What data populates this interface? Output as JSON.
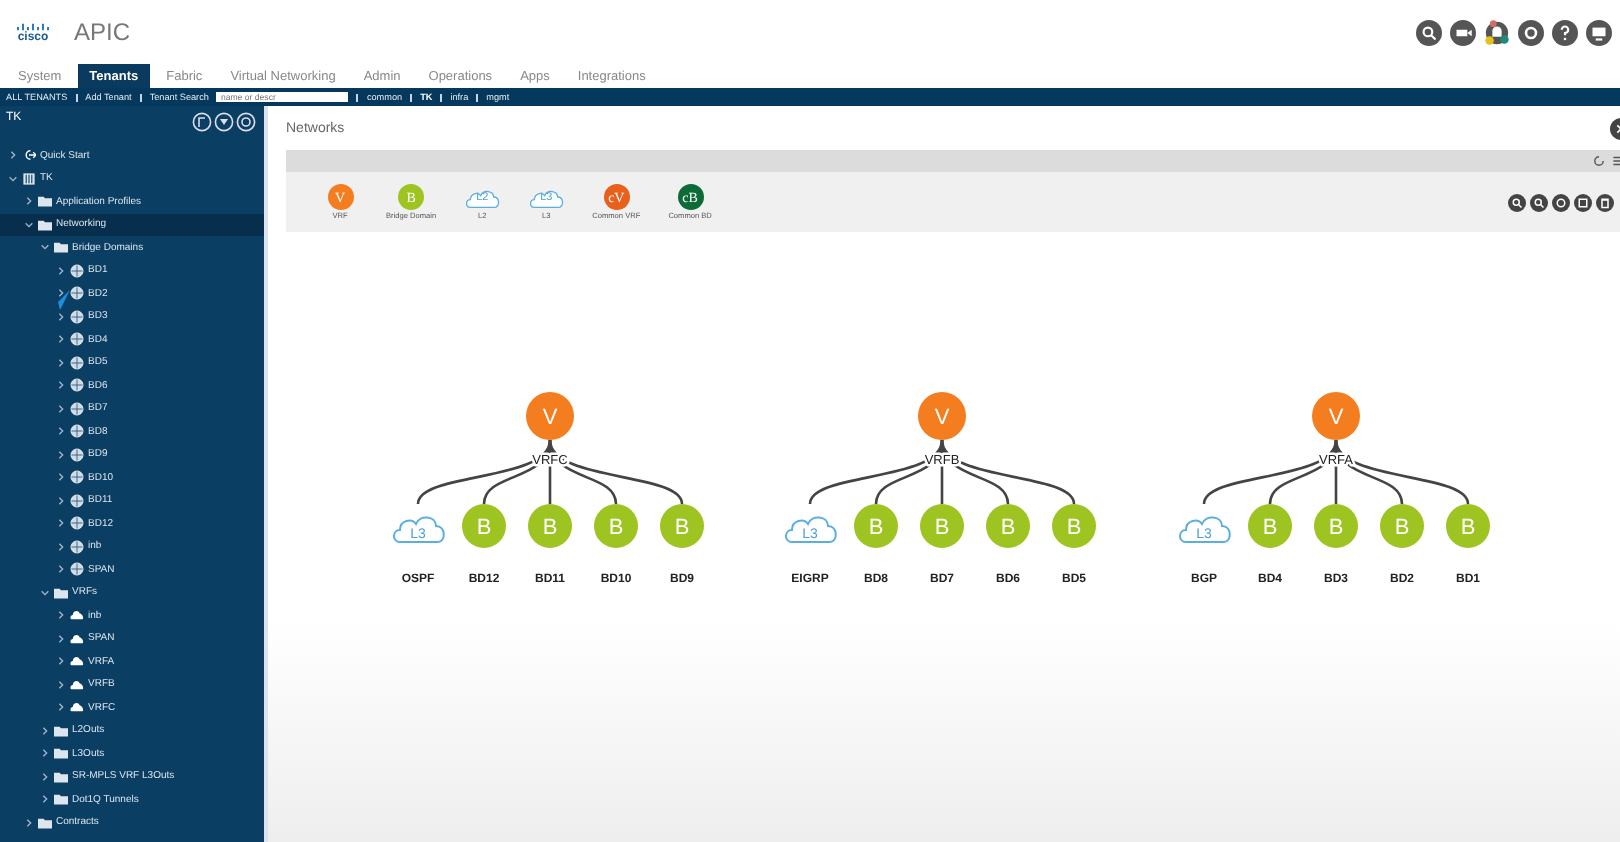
{
  "header": {
    "logo": "cisco",
    "app_name": "APIC"
  },
  "tabs": [
    {
      "label": "System",
      "selected": false
    },
    {
      "label": "Tenants",
      "selected": true
    },
    {
      "label": "Fabric",
      "selected": false
    },
    {
      "label": "Virtual Networking",
      "selected": false
    },
    {
      "label": "Admin",
      "selected": false
    },
    {
      "label": "Operations",
      "selected": false
    },
    {
      "label": "Apps",
      "selected": false
    },
    {
      "label": "Integrations",
      "selected": false
    }
  ],
  "nav_bar": [
    {
      "kind": "link",
      "label": "ALL TENANTS",
      "selected": false
    },
    {
      "kind": "link",
      "label": "Add Tenant",
      "selected": false
    },
    {
      "kind": "search",
      "label": "Tenant Search",
      "placeholder": "name or descr",
      "selected": false
    },
    {
      "kind": "link",
      "label": "common",
      "selected": false
    },
    {
      "kind": "link",
      "label": "TK",
      "selected": true
    },
    {
      "kind": "link",
      "label": "infra",
      "selected": false
    },
    {
      "kind": "link",
      "label": "mgmt",
      "selected": false
    }
  ],
  "sidebar": {
    "title": "TK",
    "tree": [
      {
        "kind": "quickstart",
        "label": "Quick Start",
        "expanded": false,
        "selected": false
      },
      {
        "kind": "tenant",
        "label": "TK",
        "expanded": true,
        "selected": false,
        "children": [
          {
            "kind": "folder",
            "label": "Application Profiles",
            "expanded": false,
            "selected": false
          },
          {
            "kind": "folder",
            "label": "Networking",
            "expanded": true,
            "selected": true,
            "children": [
              {
                "kind": "folder",
                "label": "Bridge Domains",
                "expanded": true,
                "selected": false,
                "children": [
                  {
                    "kind": "bd",
                    "label": "BD1",
                    "expanded": false,
                    "selected": false
                  },
                  {
                    "kind": "bd",
                    "label": "BD2",
                    "expanded": false,
                    "selected": false
                  },
                  {
                    "kind": "bd",
                    "label": "BD3",
                    "expanded": false,
                    "selected": false
                  },
                  {
                    "kind": "bd",
                    "label": "BD4",
                    "expanded": false,
                    "selected": false
                  },
                  {
                    "kind": "bd",
                    "label": "BD5",
                    "expanded": false,
                    "selected": false
                  },
                  {
                    "kind": "bd",
                    "label": "BD6",
                    "expanded": false,
                    "selected": false
                  },
                  {
                    "kind": "bd",
                    "label": "BD7",
                    "expanded": false,
                    "selected": false
                  },
                  {
                    "kind": "bd",
                    "label": "BD8",
                    "expanded": false,
                    "selected": false
                  },
                  {
                    "kind": "bd",
                    "label": "BD9",
                    "expanded": false,
                    "selected": false
                  },
                  {
                    "kind": "bd",
                    "label": "BD10",
                    "expanded": false,
                    "selected": false
                  },
                  {
                    "kind": "bd",
                    "label": "BD11",
                    "expanded": false,
                    "selected": false
                  },
                  {
                    "kind": "bd",
                    "label": "BD12",
                    "expanded": false,
                    "selected": false
                  },
                  {
                    "kind": "bd",
                    "label": "inb",
                    "expanded": false,
                    "selected": false
                  },
                  {
                    "kind": "bd",
                    "label": "SPAN",
                    "expanded": false,
                    "selected": false
                  }
                ]
              },
              {
                "kind": "folder",
                "label": "VRFs",
                "expanded": true,
                "selected": false,
                "children": [
                  {
                    "kind": "vrf",
                    "label": "inb",
                    "expanded": false,
                    "selected": false
                  },
                  {
                    "kind": "vrf",
                    "label": "SPAN",
                    "expanded": false,
                    "selected": false
                  },
                  {
                    "kind": "vrf",
                    "label": "VRFA",
                    "expanded": false,
                    "selected": false
                  },
                  {
                    "kind": "vrf",
                    "label": "VRFB",
                    "expanded": false,
                    "selected": false
                  },
                  {
                    "kind": "vrf",
                    "label": "VRFC",
                    "expanded": false,
                    "selected": false
                  }
                ]
              },
              {
                "kind": "folder",
                "label": "L2Outs",
                "expanded": false,
                "selected": false
              },
              {
                "kind": "folder",
                "label": "L3Outs",
                "expanded": false,
                "selected": false
              },
              {
                "kind": "folder",
                "label": "SR-MPLS VRF L3Outs",
                "expanded": false,
                "selected": false
              },
              {
                "kind": "folder",
                "label": "Dot1Q Tunnels",
                "expanded": false,
                "selected": false
              }
            ]
          },
          {
            "kind": "folder",
            "label": "Contracts",
            "expanded": false,
            "selected": false
          }
        ]
      }
    ]
  },
  "main": {
    "title": "Networks",
    "legend": [
      {
        "kind": "vrf",
        "symbol": "V",
        "label": "VRF"
      },
      {
        "kind": "bd",
        "symbol": "B",
        "label": "Bridge Domain"
      },
      {
        "kind": "cloud",
        "symbol": "L2",
        "label": "L2"
      },
      {
        "kind": "cloud",
        "symbol": "L3",
        "label": "L3"
      },
      {
        "kind": "common_vrf",
        "symbol": "cV",
        "label": "Common VRF"
      },
      {
        "kind": "common_bd",
        "symbol": "cB",
        "label": "Common BD"
      }
    ],
    "graph": [
      {
        "vrf": {
          "symbol": "V",
          "label": "VRFC"
        },
        "children": [
          {
            "kind": "cloud",
            "symbol": "L3",
            "label": "OSPF"
          },
          {
            "kind": "bd",
            "symbol": "B",
            "label": "BD12"
          },
          {
            "kind": "bd",
            "symbol": "B",
            "label": "BD11"
          },
          {
            "kind": "bd",
            "symbol": "B",
            "label": "BD10"
          },
          {
            "kind": "bd",
            "symbol": "B",
            "label": "BD9"
          }
        ]
      },
      {
        "vrf": {
          "symbol": "V",
          "label": "VRFB"
        },
        "children": [
          {
            "kind": "cloud",
            "symbol": "L3",
            "label": "EIGRP"
          },
          {
            "kind": "bd",
            "symbol": "B",
            "label": "BD8"
          },
          {
            "kind": "bd",
            "symbol": "B",
            "label": "BD7"
          },
          {
            "kind": "bd",
            "symbol": "B",
            "label": "BD6"
          },
          {
            "kind": "bd",
            "symbol": "B",
            "label": "BD5"
          }
        ]
      },
      {
        "vrf": {
          "symbol": "V",
          "label": "VRFA"
        },
        "children": [
          {
            "kind": "cloud",
            "symbol": "L3",
            "label": "BGP"
          },
          {
            "kind": "bd",
            "symbol": "B",
            "label": "BD4"
          },
          {
            "kind": "bd",
            "symbol": "B",
            "label": "BD3"
          },
          {
            "kind": "bd",
            "symbol": "B",
            "label": "BD2"
          },
          {
            "kind": "bd",
            "symbol": "B",
            "label": "BD1"
          }
        ]
      }
    ]
  }
}
